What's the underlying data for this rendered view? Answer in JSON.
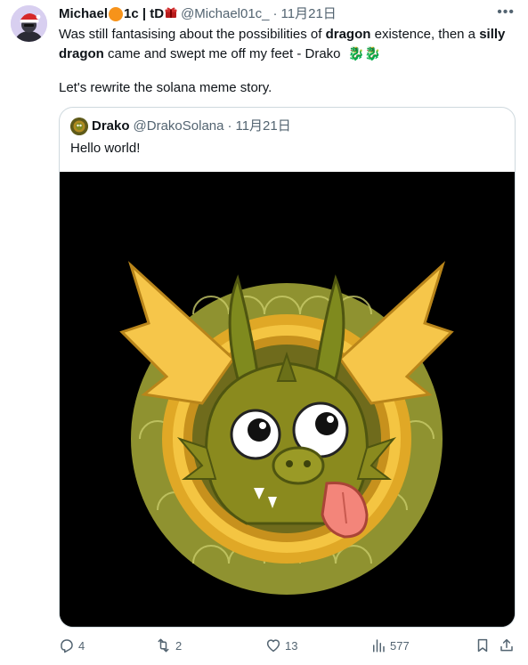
{
  "tweet": {
    "author_name": "Michael",
    "author_name_part2": "1c | tD",
    "handle": "@Michael01c_",
    "separator": "·",
    "date": "11月21日",
    "more_label": "•••",
    "line1_a": "Was still fantasising about the possibilities of ",
    "line1_bold": "dragon",
    "line1_b": " existence, then a ",
    "line2_bold": "silly dragon",
    "line2_a": " came and swept me off my feet  - Drako ",
    "dragon_emojis": "🐉🐉",
    "line3": "Let's rewrite the solana meme story."
  },
  "quote": {
    "name": "Drako",
    "handle": "@DrakoSolana",
    "separator": "·",
    "date": "11月21日",
    "text": "Hello world!"
  },
  "actions": {
    "replies": "4",
    "retweets": "2",
    "likes": "13",
    "views": "577"
  },
  "colors": {
    "text": "#0f1419",
    "muted": "#536471",
    "border": "#cfd9de",
    "dragon_green": "#8a8a1e",
    "wing_yellow": "#f6c64a",
    "coin_gold": "#d89c1c"
  }
}
